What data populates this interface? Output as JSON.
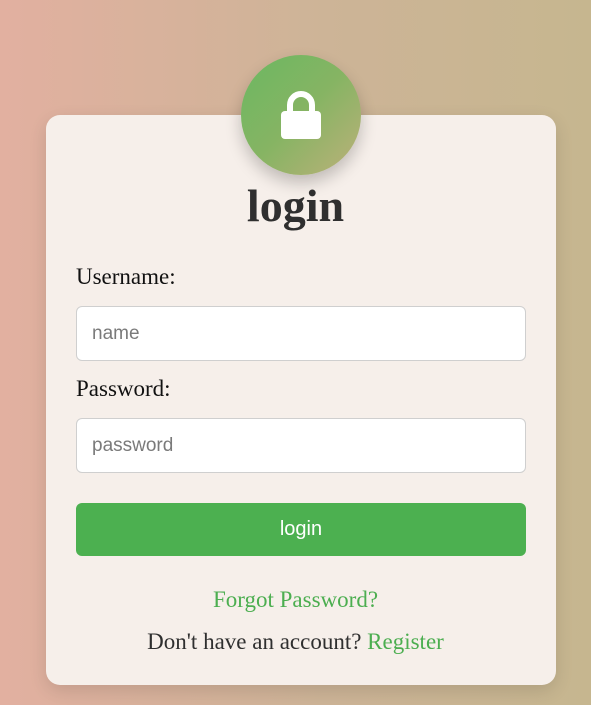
{
  "form": {
    "title": "login",
    "lock_icon": "lock-icon",
    "username_label": "Username:",
    "username_value": "",
    "username_placeholder": "name",
    "password_label": "Password:",
    "password_value": "",
    "password_placeholder": "password",
    "submit_label": "login",
    "forgot_link": "Forgot Password?",
    "no_account_text": "Don't have an account?",
    "register_link": "Register"
  },
  "colors": {
    "accent": "#4cb050",
    "link": "#4cae50",
    "card": "#f6efea"
  }
}
